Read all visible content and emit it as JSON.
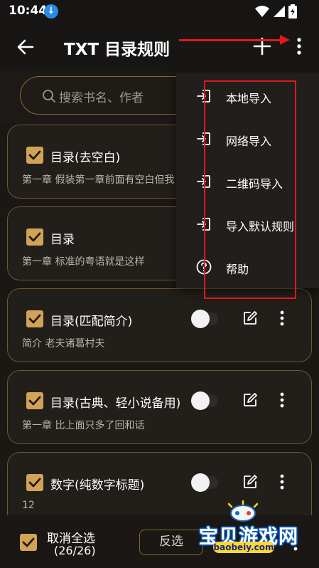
{
  "status_bar": {
    "time": "10:44",
    "icons": [
      "download-icon",
      "wifi-icon",
      "signal-icon",
      "battery-icon"
    ]
  },
  "app_bar": {
    "title": "TXT 目录规则",
    "icons": [
      "back-arrow-icon",
      "plus-icon",
      "more-vertical-icon"
    ]
  },
  "search": {
    "placeholder": "搜索书名、作者"
  },
  "rules": [
    {
      "name": "目录(去空白)",
      "description": "第一章 假装第一章前面有空白但我",
      "checked": true
    },
    {
      "name": "目录",
      "description": "第一章 标准的粤语就是这样",
      "checked": true
    },
    {
      "name": "目录(匹配简介)",
      "description": "简介 老夫诸葛村夫",
      "checked": true,
      "enabled": false
    },
    {
      "name": "目录(古典、轻小说备用)",
      "description": "第一章 比上面只多了回和话",
      "checked": true,
      "enabled": false
    },
    {
      "name": "数字(纯数字标题)",
      "description": "12",
      "checked": true,
      "enabled": false
    }
  ],
  "menu": {
    "items": [
      {
        "label": "本地导入",
        "icon": "import-icon"
      },
      {
        "label": "网络导入",
        "icon": "import-icon"
      },
      {
        "label": "二维码导入",
        "icon": "import-icon"
      },
      {
        "label": "导入默认规则",
        "icon": "import-icon"
      },
      {
        "label": "帮助",
        "icon": "help-circle-icon"
      }
    ]
  },
  "bottom_bar": {
    "select_all_label": "取消全选",
    "count": "(26/26)",
    "invert_label": "反选"
  },
  "watermark": {
    "text": "宝贝游戏网",
    "url": "baobeiy.com"
  },
  "colors": {
    "accent": "#d2a356",
    "card_border": "#6e5732",
    "annotation_red": "#e0191e",
    "background": "#1c1916"
  }
}
